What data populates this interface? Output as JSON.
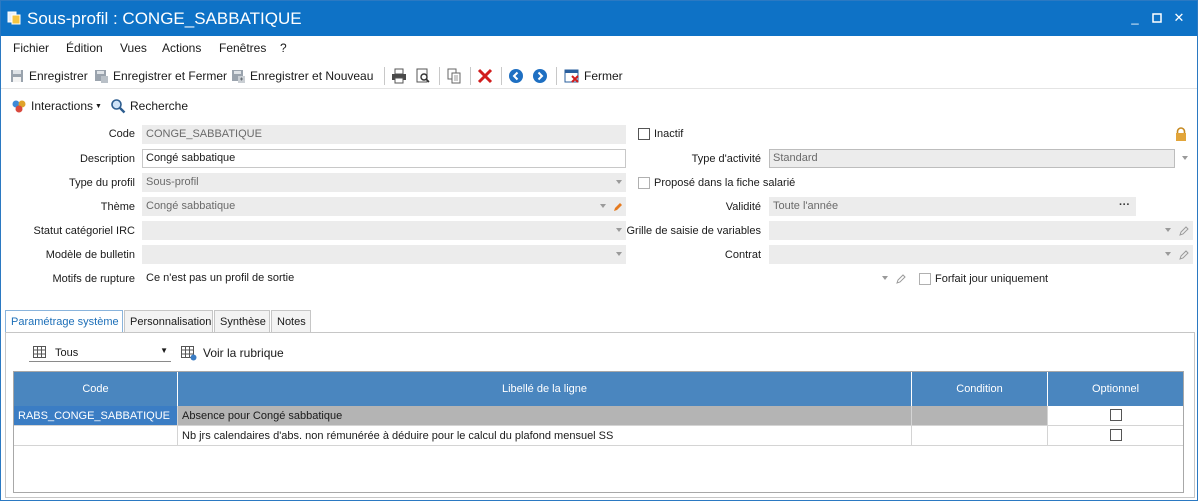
{
  "window": {
    "title": "Sous-profil : CONGE_SABBATIQUE",
    "minimize_icon": "minimize-icon",
    "maximize_icon": "maximize-icon",
    "close_icon": "close-icon"
  },
  "menu": {
    "items": [
      "Fichier",
      "Édition",
      "Vues",
      "Actions",
      "Fenêtres",
      "?"
    ]
  },
  "toolbar": {
    "save": "Enregistrer",
    "save_close": "Enregistrer et Fermer",
    "save_new": "Enregistrer et Nouveau",
    "close": "Fermer"
  },
  "toolbar2": {
    "interactions": "Interactions",
    "search": "Recherche"
  },
  "form": {
    "code_label": "Code",
    "code_value": "CONGE_SABBATIQUE",
    "description_label": "Description",
    "description_value": "Congé sabbatique",
    "type_profil_label": "Type du profil",
    "type_profil_value": "Sous-profil",
    "theme_label": "Thème",
    "theme_value": "Congé sabbatique",
    "statut_label": "Statut catégoriel IRC",
    "statut_value": "",
    "modele_label": "Modèle de bulletin",
    "modele_value": "",
    "motifs_label": "Motifs de rupture",
    "motifs_value": "Ce n'est pas un profil de sortie",
    "inactif_label": "Inactif",
    "type_activite_label": "Type d'activité",
    "type_activite_value": "Standard",
    "propose_label": "Proposé dans la fiche salarié",
    "validite_label": "Validité",
    "validite_value": "Toute l'année",
    "validite_more": "···",
    "grille_label": "Grille de saisie de variables",
    "grille_value": "",
    "contrat_label": "Contrat",
    "contrat_value": "",
    "forfait_label": "Forfait jour uniquement"
  },
  "tabs": [
    "Paramétrage système",
    "Personnalisation",
    "Synthèse",
    "Notes"
  ],
  "panel": {
    "filter_value": "Tous",
    "see_rubrique": "Voir la rubrique"
  },
  "grid": {
    "headers": [
      "Code",
      "Libellé de la ligne",
      "Condition",
      "Optionnel"
    ],
    "rows": [
      {
        "code": "RABS_CONGE_SABBATIQUE",
        "libelle": "Absence pour Congé sabbatique",
        "condition": ""
      },
      {
        "code": "",
        "libelle": "Nb jrs calendaires d'abs. non rémunérée à déduire pour le calcul du plafond mensuel SS",
        "condition": ""
      }
    ]
  },
  "colors": {
    "titlebar": "#0e72c6",
    "grid_header": "#4a86bf",
    "selected_cell": "#3b7dc4",
    "selected_row": "#b4b4b4"
  }
}
